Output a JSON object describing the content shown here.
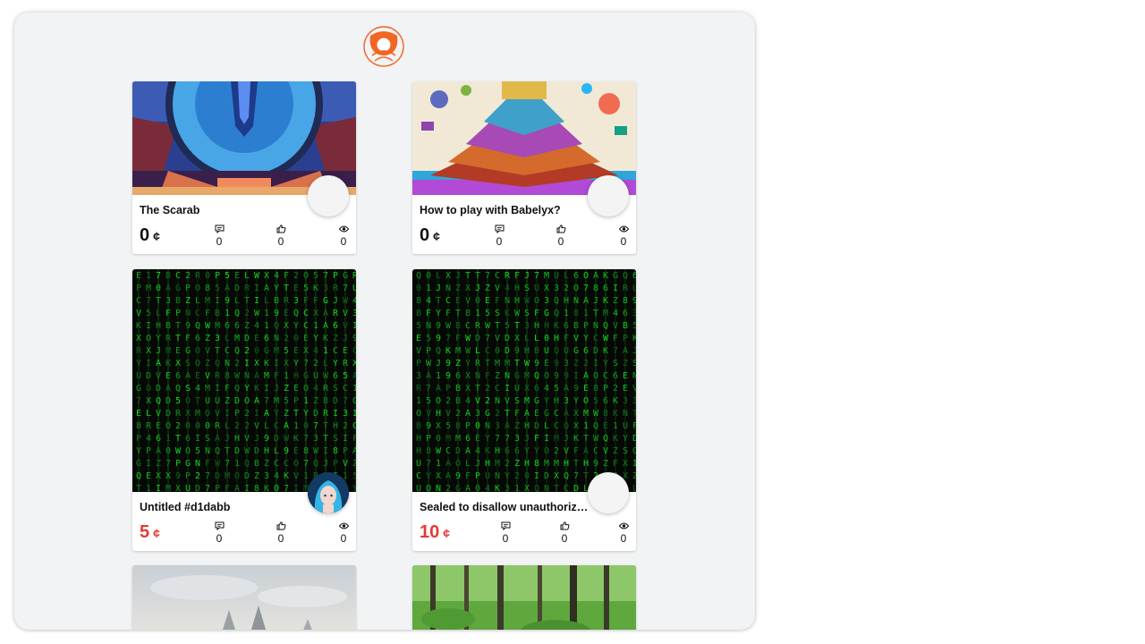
{
  "app": {
    "logo_icon": "app-logo-icon"
  },
  "colors": {
    "window_bg": "#f2f3f5",
    "price_red": "#e53935",
    "logo_orange": "#f26522"
  },
  "cards": [
    {
      "title": "The Scarab",
      "price": "0",
      "currency": "¢",
      "price_highlight": false,
      "comments": "0",
      "likes": "0",
      "views": "0",
      "image": "pixel-art-portal",
      "avatar": "empty"
    },
    {
      "title": "How to play with Babelyx?",
      "price": "0",
      "currency": "¢",
      "price_highlight": false,
      "comments": "0",
      "likes": "0",
      "views": "0",
      "image": "colorful-cube-tower",
      "avatar": "empty"
    },
    {
      "title": "Untitled #d1dabb",
      "price": "5",
      "currency": "¢",
      "price_highlight": true,
      "comments": "0",
      "likes": "0",
      "views": "0",
      "image": "matrix-code-rain",
      "avatar": "blue-hair-portrait"
    },
    {
      "title": "Sealed to disallow unauthoriz…",
      "price": "10",
      "currency": "¢",
      "price_highlight": true,
      "comments": "0",
      "likes": "0",
      "views": "0",
      "image": "matrix-code-rain",
      "avatar": "empty"
    },
    {
      "image": "snowy-trees-sky"
    },
    {
      "image": "green-forest"
    }
  ]
}
